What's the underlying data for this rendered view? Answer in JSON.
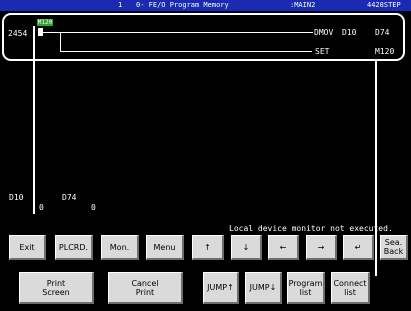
{
  "header": {
    "segment": "1",
    "title": "0- FE/O Program Memory",
    "program": ":MAIN2",
    "steps": "4428STEP"
  },
  "ladder": {
    "step_number": "2454",
    "contact_device": "M120",
    "rung1": {
      "instruction": "DMOV",
      "operand1": "D10",
      "operand2": "D74"
    },
    "rung2": {
      "instruction": "SET",
      "operand1": "M120"
    }
  },
  "monitor": {
    "items": [
      {
        "device": "D10",
        "value": "0"
      },
      {
        "device": "D74",
        "value": "0"
      }
    ]
  },
  "status": {
    "message": "Local device monitor not executed."
  },
  "buttons": {
    "exit": "Exit",
    "plcrd": "PLCRD.",
    "mon": "Mon.",
    "menu": "Menu",
    "up": "↑",
    "down": "↓",
    "left": "←",
    "right": "→",
    "enter": "↵",
    "search_back": "Sea.\nBack",
    "print_screen": "Print\nScreen",
    "cancel_print": "Cancel\nPrint",
    "jump_up": "JUMP↑",
    "jump_down": "JUMP↓",
    "program_list": "Program\nlist",
    "connect_list": "Connect\nlist"
  },
  "colors": {
    "background": "#000000",
    "header": "#1a2bb0",
    "contact_on": "#2ba52b",
    "button": "#dadada"
  }
}
